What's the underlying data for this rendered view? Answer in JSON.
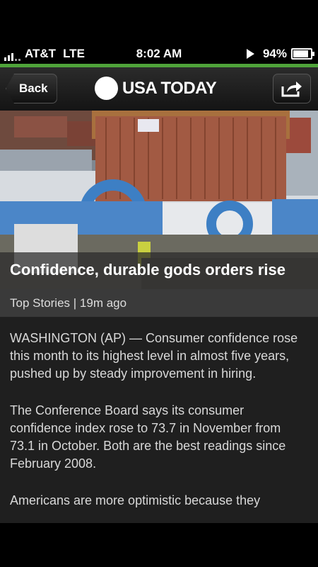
{
  "status_bar": {
    "carrier": "AT&T",
    "network": "LTE",
    "time": "8:02 AM",
    "battery_percent": "94%",
    "battery_level": 0.94,
    "signal_bars": 3,
    "icons": [
      "signal-icon",
      "play-icon",
      "battery-icon"
    ]
  },
  "nav": {
    "back_label": "Back",
    "brand": "USA TODAY",
    "share_icon": "share-icon",
    "accent_color": "#4fa33a"
  },
  "article": {
    "headline": "Confidence, durable gods orders rise",
    "section": "Top Stories",
    "age": "19m ago",
    "paragraphs": [
      "WASHINGTON (AP) —  Consumer confidence rose this month to its highest level in almost five years, pushed up by steady improvement in hiring.",
      "The Conference Board says its consumer confidence index rose to 73.7 in November from 73.1 in October. Both are the best readings since February 2008.",
      "Americans are more optimistic because they"
    ]
  }
}
